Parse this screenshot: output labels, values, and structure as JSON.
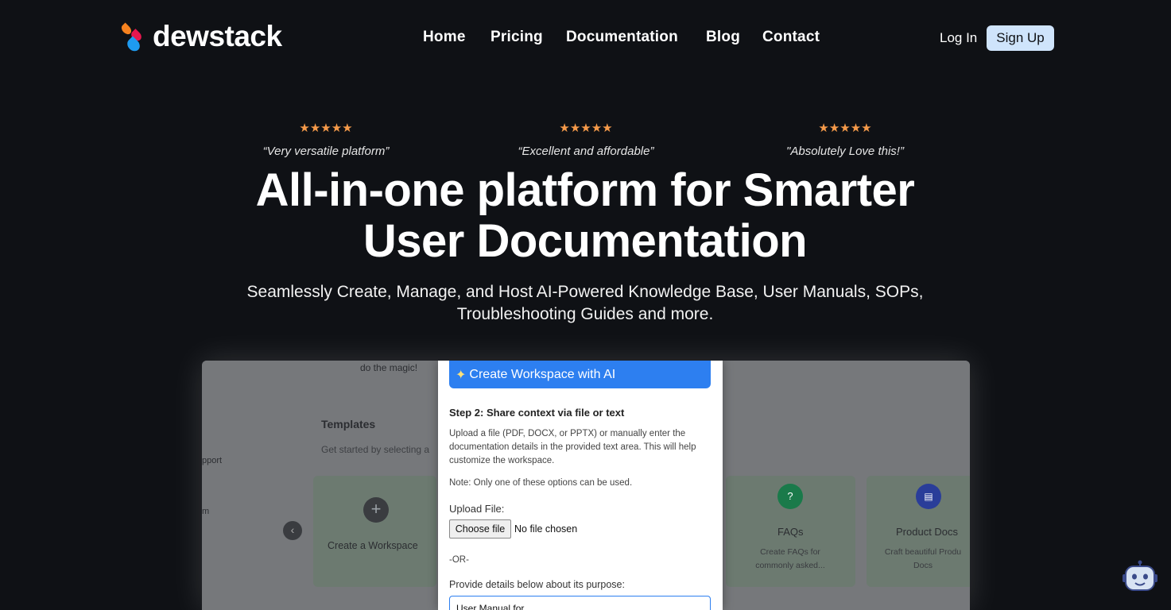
{
  "brand": {
    "name": "dewstack"
  },
  "nav": {
    "links": [
      "Home",
      "Pricing",
      "Documentation",
      "Blog",
      "Contact"
    ],
    "login": "Log In",
    "signup": "Sign Up"
  },
  "testimonials": [
    {
      "stars": "★★★★★",
      "quote": "“Very versatile platform”"
    },
    {
      "stars": "★★★★★",
      "quote": "“Excellent and affordable”"
    },
    {
      "stars": "★★★★★",
      "quote": "\"Absolutely Love this!”"
    }
  ],
  "hero": {
    "title_line1": "All-in-one platform for Smarter",
    "title_line2": "User Documentation",
    "subtitle_line1": "Seamlessly Create, Manage, and Host AI-Powered Knowledge Base, User Manuals, SOPs,",
    "subtitle_line2": "Troubleshooting Guides and more."
  },
  "preview": {
    "bg_magic": "do the magic!",
    "templates_title": "Templates",
    "templates_sub": "Get started by selecting a",
    "side_support": "pport",
    "side_m": "m",
    "card_create": "Create a Workspace",
    "card_faqs": "FAQs",
    "card_faqs_desc": "Create FAQs for commonly asked...",
    "card_product": "Product Docs",
    "card_product_desc": "Craft beautiful Produ Docs",
    "modal": {
      "title": "Create Workspace with AI",
      "step": "Step 2: Share context via file or text",
      "desc": "Upload a file (PDF, DOCX, or PPTX) or manually enter the documentation details in the provided text area. This will help customize the workspace.",
      "note": "Note: Only one of these options can be used.",
      "upload_label": "Upload File:",
      "choose_file": "Choose file",
      "no_file": "No file chosen",
      "or": "-OR-",
      "provide": "Provide details below about its purpose:",
      "textarea_value": "User Manual for"
    }
  },
  "colors": {
    "background": "#0f1115",
    "stars": "#f59a4a",
    "signup_bg": "#cfe4fb",
    "modal_header": "#2d7ff0"
  },
  "icons": [
    "logo-drops-icon",
    "sparkle-icon",
    "plus-icon",
    "chevron-left-icon",
    "question-icon",
    "docs-icon",
    "chat-bot-icon"
  ]
}
